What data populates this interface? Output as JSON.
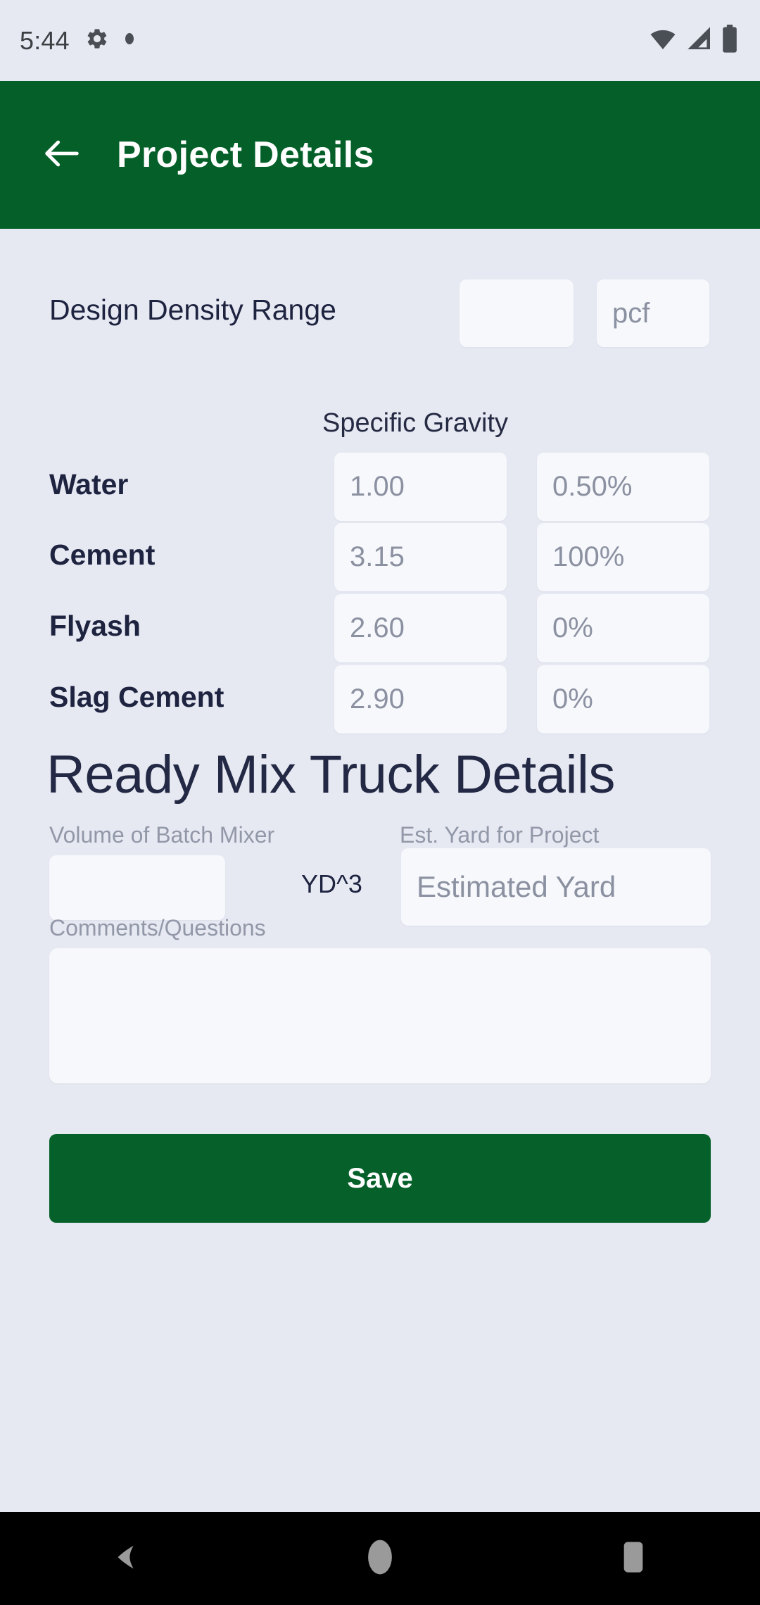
{
  "status_bar": {
    "clock": "5:44",
    "icons_left": [
      "gear-icon",
      "dot-icon"
    ],
    "icons_right": [
      "wifi-icon",
      "cell-signal-icon",
      "battery-icon"
    ]
  },
  "app_bar": {
    "back_icon": "arrow-left-icon",
    "title": "Project Details",
    "background_color": "#046028"
  },
  "form": {
    "density": {
      "label": "Design Density Range",
      "value": "",
      "value_placeholder": "",
      "unit_value": "",
      "unit_placeholder": "pcf"
    },
    "specific_gravity_header": "Specific Gravity",
    "materials": [
      {
        "label": "Water",
        "sg_value": "",
        "sg_placeholder": "1.00",
        "pct_value": "",
        "pct_placeholder": "0.50%"
      },
      {
        "label": "Cement",
        "sg_value": "",
        "sg_placeholder": "3.15",
        "pct_value": "",
        "pct_placeholder": "100%"
      },
      {
        "label": "Flyash",
        "sg_value": "",
        "sg_placeholder": "2.60",
        "pct_value": "",
        "pct_placeholder": "0%"
      },
      {
        "label": "Slag Cement",
        "sg_value": "",
        "sg_placeholder": "2.90",
        "pct_value": "",
        "pct_placeholder": "0%"
      }
    ]
  },
  "truck_section": {
    "heading": "Ready Mix Truck Details",
    "volume_label": "Volume of Batch Mixer",
    "volume_value": "",
    "volume_placeholder": "",
    "volume_unit": "YD^3",
    "estyard_label": "Est. Yard for Project",
    "estyard_value": "",
    "estyard_placeholder": "Estimated Yard",
    "comments_label": "Comments/Questions",
    "comments_value": "",
    "comments_placeholder": ""
  },
  "save_button": {
    "label": "Save",
    "color": "#056029"
  },
  "nav_bar": {
    "back_icon": "triangle-back-icon",
    "home_icon": "circle-home-icon",
    "recents_icon": "square-recents-icon"
  },
  "colors": {
    "page_background": "#e6e9f2",
    "field_background": "#f7f8fc",
    "brand_green": "#046028",
    "text_dark": "#1e2340",
    "text_muted": "#8b91a1"
  }
}
